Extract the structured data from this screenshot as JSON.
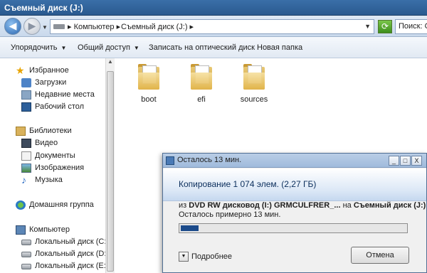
{
  "window": {
    "title": "Съемный диск (J:)"
  },
  "address": {
    "back_glyph": "◀",
    "forward_glyph": "▶",
    "crumbs": [
      "▸ Компьютер ▸",
      "Съемный диск (J:) ▸"
    ],
    "search_text": "Поиск: С"
  },
  "toolbar": {
    "organize": "Упорядочить",
    "share": "Общий доступ",
    "burn": "Записать на оптический диск",
    "new_folder": "Новая папка"
  },
  "sidebar": {
    "favorites": {
      "label": "Избранное",
      "items": [
        "Загрузки",
        "Недавние места",
        "Рабочий стол"
      ]
    },
    "libraries": {
      "label": "Библиотеки",
      "items": [
        "Видео",
        "Документы",
        "Изображения",
        "Музыка"
      ]
    },
    "homegroup": "Домашняя группа",
    "computer": {
      "label": "Компьютер",
      "items": [
        "Локальный диск (C:)",
        "Локальный диск (D:)",
        "Локальный диск (E:)"
      ]
    }
  },
  "folders": [
    "boot",
    "efi",
    "sources"
  ],
  "copy_dialog": {
    "title": "Осталось 13 мин.",
    "heading": "Копирование 1 074 элем. (2,27 ГБ)",
    "from_prefix": "из",
    "source": "DVD RW дисковод (I:) GRMCULFRER_...",
    "to_prefix": "на",
    "destination": "Съемный диск (J:)",
    "remaining": "Осталось примерно 13 мин.",
    "progress": 0.08,
    "more_label": "Подробнее",
    "cancel_label": "Отмена",
    "minimize_glyph": "_",
    "maximize_glyph": "□",
    "close_glyph": "X"
  },
  "colors": {
    "progress_fill": "#1b4a8a",
    "title_bar": "#2a5a8f"
  }
}
